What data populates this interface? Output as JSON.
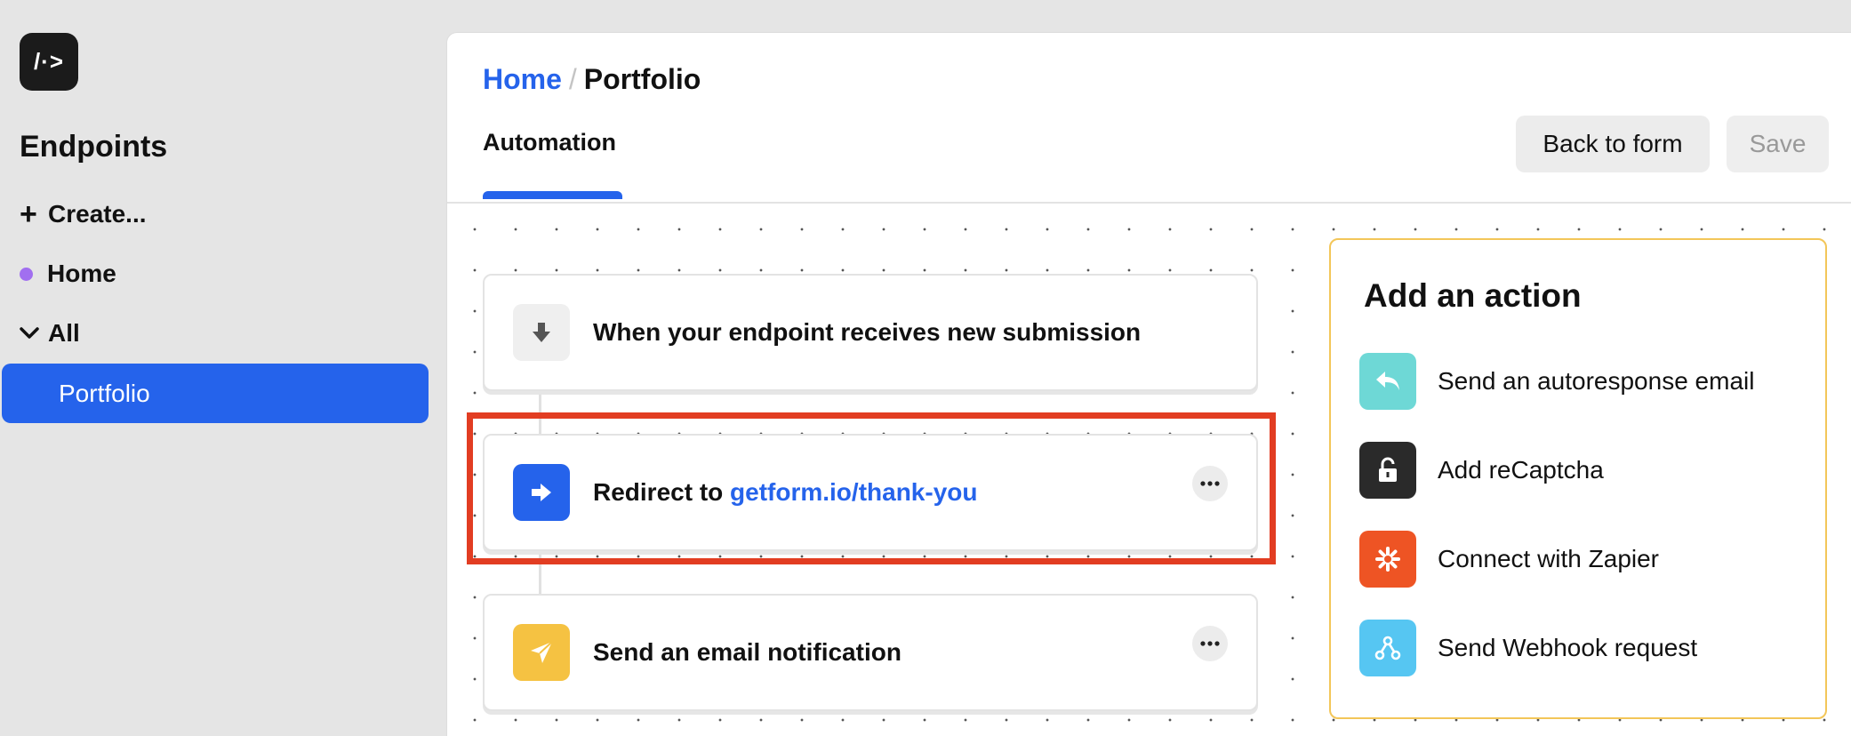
{
  "sidebar": {
    "logo_text": "/·>",
    "title": "Endpoints",
    "create_label": "Create...",
    "home_label": "Home",
    "all_label": "All",
    "active_item": "Portfolio",
    "home_dot_color": "#a16ff0"
  },
  "header": {
    "breadcrumb_home": "Home",
    "breadcrumb_sep": "/",
    "breadcrumb_current": "Portfolio",
    "tab_label": "Automation",
    "back_button": "Back to form",
    "save_button": "Save"
  },
  "workflow": {
    "trigger": {
      "icon": "arrow-down-icon",
      "text": "When your endpoint receives new submission"
    },
    "steps": [
      {
        "icon": "arrow-right-icon",
        "prefix": "Redirect to",
        "link": "getform.io/thank-you",
        "highlighted": true
      },
      {
        "icon": "paper-plane-icon",
        "text": "Send an email notification"
      }
    ]
  },
  "actions": {
    "title": "Add an action",
    "items": [
      {
        "label": "Send an autoresponse email",
        "icon": "reply-icon",
        "color": "#6ed8d6"
      },
      {
        "label": "Add reCaptcha",
        "icon": "unlock-icon",
        "color": "#2a2a2a"
      },
      {
        "label": "Connect with Zapier",
        "icon": "zapier-icon",
        "color": "#ee5424"
      },
      {
        "label": "Send Webhook request",
        "icon": "webhook-icon",
        "color": "#56c6f2"
      }
    ]
  },
  "colors": {
    "accent": "#2563eb",
    "highlight": "#e23d22",
    "panel_border": "#f3c659"
  }
}
